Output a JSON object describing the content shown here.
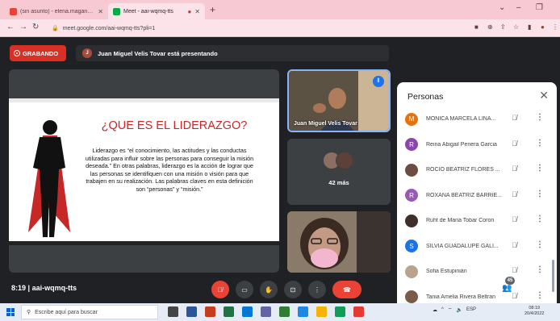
{
  "browser": {
    "tabs": [
      {
        "title": "(sin asunto) - elena.magana@un",
        "active": false
      },
      {
        "title": "Meet - aai-wqmq-tts",
        "active": true
      }
    ],
    "url": "meet.google.com/aai-wqmq-tts?pli=1"
  },
  "meet": {
    "recording_label": "GRABANDO",
    "presenter_initial": "J",
    "presenting_text": "Juan Miguel Velis Tovar está presentando",
    "slide": {
      "title": "¿QUE ES EL LIDERAZGO?",
      "body": "Liderazgo es “el conocimiento, las actitudes y las conductas utilizadas para influir sobre las personas para conseguir la misión deseada.” En otras palabras, liderazgo es la acción de lograr que las personas se identifiquen con una misión o visión para que trabajen en su realización. Las palabras claves en esta definición son “personas” y “misión.”"
    },
    "tiles": {
      "presenter_name": "Juan Miguel Velis Tovar",
      "more_label": "42 más"
    },
    "time": "8:19",
    "meeting_code": "aai-wqmq-tts",
    "participants_count": "45"
  },
  "people_panel": {
    "title": "Personas",
    "people": [
      {
        "name": "MONICA MARCELA LINA...",
        "initial": "M",
        "color": "#e8710a"
      },
      {
        "name": "Reina Abigail Periera Garcia",
        "initial": "R",
        "color": "#8e44ad"
      },
      {
        "name": "ROCIO BEATRIZ FLORES ...",
        "initial": "",
        "color": "#6d4c41"
      },
      {
        "name": "ROXANA BEATRIZ BARRIE...",
        "initial": "R",
        "color": "#9b59b6"
      },
      {
        "name": "Ruht de Maria Tobar Coron",
        "initial": "",
        "color": "#3e2f2a"
      },
      {
        "name": "SILVIA GUADALUPE GALI...",
        "initial": "S",
        "color": "#1a73e8"
      },
      {
        "name": "Sofia Estupinián",
        "initial": "",
        "color": "#b7a38e"
      },
      {
        "name": "Tania Amelia Rivera Beltran",
        "initial": "",
        "color": "#7a5a48"
      }
    ]
  },
  "taskbar": {
    "search_placeholder": "Escribe aquí para buscar",
    "language": "ESP",
    "time": "08:19",
    "date": "20/4/2022"
  }
}
